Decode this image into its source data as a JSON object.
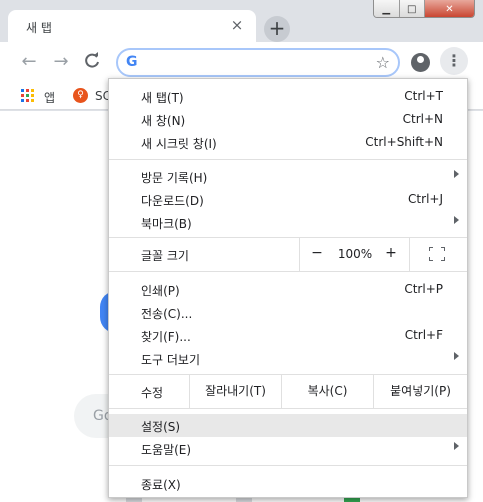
{
  "window": {
    "tab_title": "새 탭",
    "tab_close": "×",
    "new_tab": "+",
    "controls": {
      "minimize": "▁",
      "maximize": "□",
      "close": "✕"
    }
  },
  "toolbar": {
    "back": "←",
    "forward": "→",
    "reload": "C",
    "google_g": "G",
    "omnibox_value": "",
    "star": "☆",
    "menu": "⋮"
  },
  "bookmarks": {
    "apps_label": "앱",
    "site_label": "SC",
    "site_icon_glyph": "♀"
  },
  "page": {
    "search_hint": "Go"
  },
  "menu": {
    "new_tab": {
      "label": "새 탭(T)",
      "shortcut": "Ctrl+T"
    },
    "new_window": {
      "label": "새 창(N)",
      "shortcut": "Ctrl+N"
    },
    "incognito": {
      "label": "새 시크릿 창(I)",
      "shortcut": "Ctrl+Shift+N"
    },
    "history": {
      "label": "방문 기록(H)"
    },
    "downloads": {
      "label": "다운로드(D)",
      "shortcut": "Ctrl+J"
    },
    "bookmarks": {
      "label": "북마크(B)"
    },
    "zoom": {
      "label": "글꼴 크기",
      "minus": "−",
      "value": "100%",
      "plus": "+"
    },
    "print": {
      "label": "인쇄(P)",
      "shortcut": "Ctrl+P"
    },
    "cast": {
      "label": "전송(C)..."
    },
    "find": {
      "label": "찾기(F)...",
      "shortcut": "Ctrl+F"
    },
    "more_tools": {
      "label": "도구 더보기"
    },
    "edit": {
      "label": "수정",
      "cut": "잘라내기(T)",
      "copy": "복사(C)",
      "paste": "붙여넣기(P)"
    },
    "settings": {
      "label": "설정(S)"
    },
    "help": {
      "label": "도움말(E)"
    },
    "exit": {
      "label": "종료(X)"
    }
  }
}
